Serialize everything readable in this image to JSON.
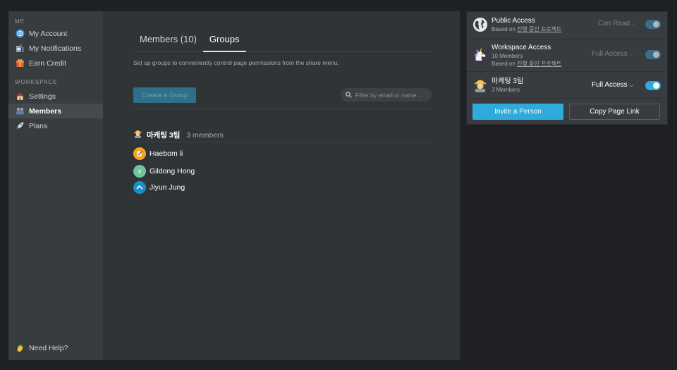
{
  "sidebar": {
    "me_label": "ME",
    "workspace_label": "WORKSPACE",
    "items": [
      {
        "label": "My Account",
        "icon": "account-icon"
      },
      {
        "label": "My Notifications",
        "icon": "notifications-icon"
      },
      {
        "label": "Earn Credit",
        "icon": "gift-icon"
      },
      {
        "label": "Settings",
        "icon": "house-icon"
      },
      {
        "label": "Members",
        "icon": "people-icon"
      },
      {
        "label": "Plans",
        "icon": "rocket-icon"
      }
    ],
    "active_item": "Members",
    "help_label": "Need Help?"
  },
  "main": {
    "tabs": [
      {
        "label": "Members (10)"
      },
      {
        "label": "Groups"
      }
    ],
    "active_tab": "Groups",
    "description": "Set up groups to conveniently control page permissions from the share menu.",
    "create_group_label": "Create a Group",
    "filter_placeholder": "Filter by email or name...",
    "group": {
      "name": "마케팅 3팀",
      "count_label": "3 members",
      "members": [
        {
          "name": "Haebom li",
          "avatar_color": "#f5a623"
        },
        {
          "name": "Gildong Hong",
          "avatar_color": "#6cc4a1"
        },
        {
          "name": "Jiyun Jung",
          "avatar_color": "#1a8fc9"
        }
      ]
    }
  },
  "share": {
    "rows": [
      {
        "title": "Public Access",
        "based_on_prefix": "Based on",
        "based_on_link": "진행 중인 프로젝트",
        "permission": "Can Read",
        "enabled": false
      },
      {
        "title": "Workspace Access",
        "subtitle": "10 Members",
        "based_on_prefix": "Based on",
        "based_on_link": "진행 중인 프로젝트",
        "permission": "Full Access",
        "enabled": false
      },
      {
        "title": "마케팅 3팀",
        "subtitle": "3 Members",
        "permission": "Full Access",
        "enabled": true
      }
    ],
    "invite_label": "Invite a Person",
    "copy_link_label": "Copy Page Link"
  },
  "colors": {
    "accent": "#2eaadc",
    "window_bg": "#2f3437",
    "sidebar_bg": "#373c3f"
  }
}
